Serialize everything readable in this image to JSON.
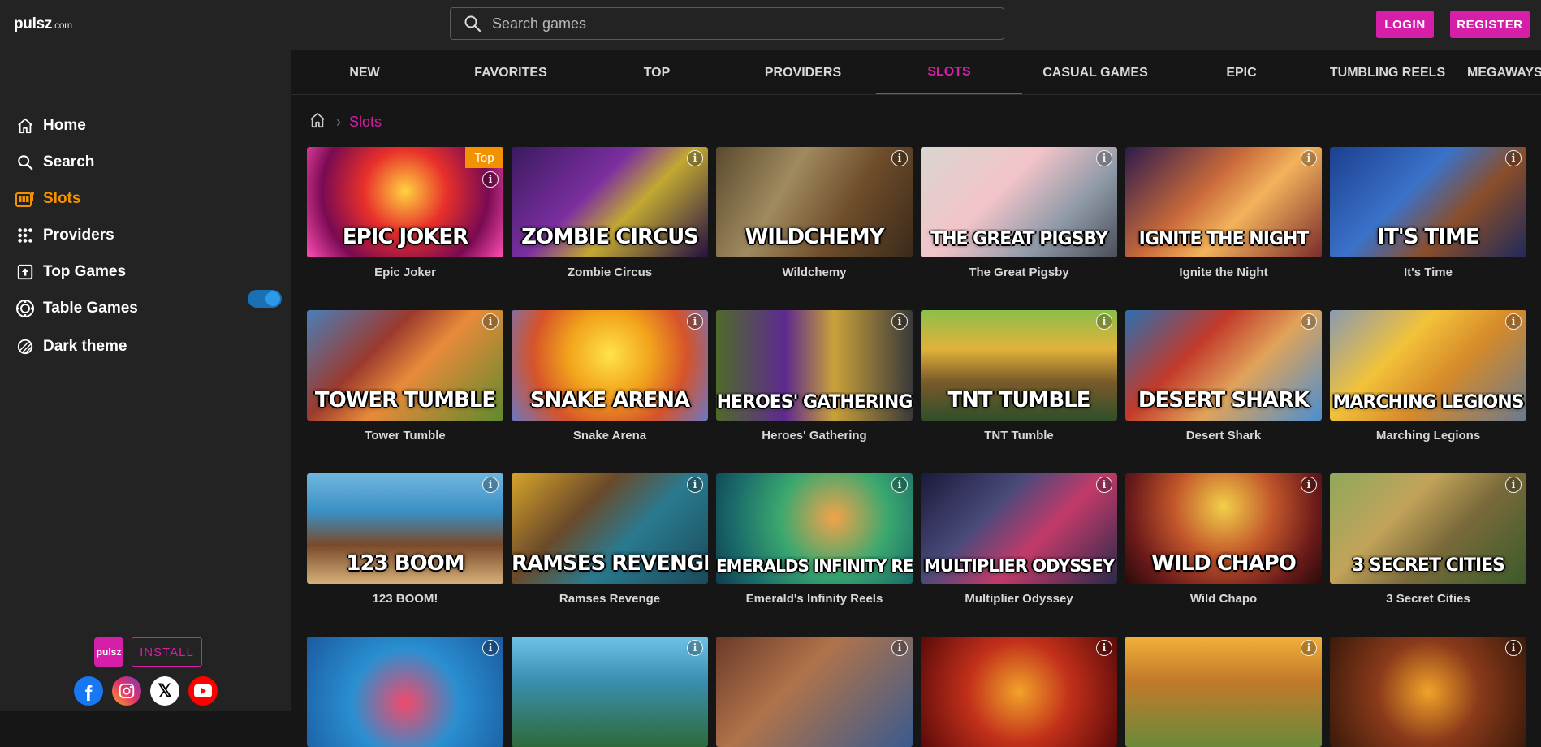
{
  "header": {
    "logo_main": "pulsz",
    "logo_suffix": ".com",
    "search_placeholder": "Search games",
    "login_label": "LOGIN",
    "register_label": "REGISTER"
  },
  "sidebar": {
    "items": [
      {
        "label": "Home",
        "icon": "home-icon"
      },
      {
        "label": "Search",
        "icon": "search-icon"
      },
      {
        "label": "Slots",
        "icon": "slots-icon"
      },
      {
        "label": "Providers",
        "icon": "providers-icon"
      },
      {
        "label": "Top Games",
        "icon": "top-games-icon"
      },
      {
        "label": "Table Games",
        "icon": "table-games-icon"
      }
    ],
    "dark_theme_label": "Dark theme",
    "dark_theme_on": true,
    "install_logo": "pulsz",
    "install_label": "INSTALL"
  },
  "tabs": [
    "NEW",
    "FAVORITES",
    "TOP",
    "PROVIDERS",
    "SLOTS",
    "CASUAL GAMES",
    "EPIC",
    "TUMBLING REELS",
    "MEGAWAYS"
  ],
  "active_tab": "SLOTS",
  "breadcrumb": {
    "current": "Slots"
  },
  "colors": {
    "accent": "#d61fa8",
    "active_nav": "#f39200",
    "badge": "#f39200"
  },
  "games": [
    {
      "name": "Epic Joker",
      "art": "EPIC JOKER",
      "badge": "Top"
    },
    {
      "name": "Zombie Circus",
      "art": "ZOMBIE CIRCUS"
    },
    {
      "name": "Wildchemy",
      "art": "WILDCHEMY"
    },
    {
      "name": "The Great Pigsby",
      "art": "THE GREAT PIGSBY"
    },
    {
      "name": "Ignite the Night",
      "art": "IGNITE THE NIGHT"
    },
    {
      "name": "It's Time",
      "art": "IT'S TIME"
    },
    {
      "name": "Tower Tumble",
      "art": "TOWER TUMBLE"
    },
    {
      "name": "Snake Arena",
      "art": "SNAKE ARENA"
    },
    {
      "name": "Heroes' Gathering",
      "art": "HEROES' GATHERING"
    },
    {
      "name": "TNT Tumble",
      "art": "TNT TUMBLE"
    },
    {
      "name": "Desert Shark",
      "art": "DESERT SHARK"
    },
    {
      "name": "Marching Legions",
      "art": "MARCHING LEGIONS"
    },
    {
      "name": "123 BOOM!",
      "art": "123 BOOM"
    },
    {
      "name": "Ramses Revenge",
      "art": "RAMSES REVENGE"
    },
    {
      "name": "Emerald's Infinity Reels",
      "art": "EMERALDS INFINITY REELS"
    },
    {
      "name": "Multiplier Odyssey",
      "art": "MULTIPLIER ODYSSEY"
    },
    {
      "name": "Wild Chapo",
      "art": "WILD CHAPO"
    },
    {
      "name": "3 Secret Cities",
      "art": "3 SECRET CITIES"
    },
    {
      "name": "",
      "art": ""
    },
    {
      "name": "",
      "art": ""
    },
    {
      "name": "",
      "art": ""
    },
    {
      "name": "",
      "art": ""
    },
    {
      "name": "",
      "art": ""
    },
    {
      "name": "",
      "art": ""
    }
  ]
}
